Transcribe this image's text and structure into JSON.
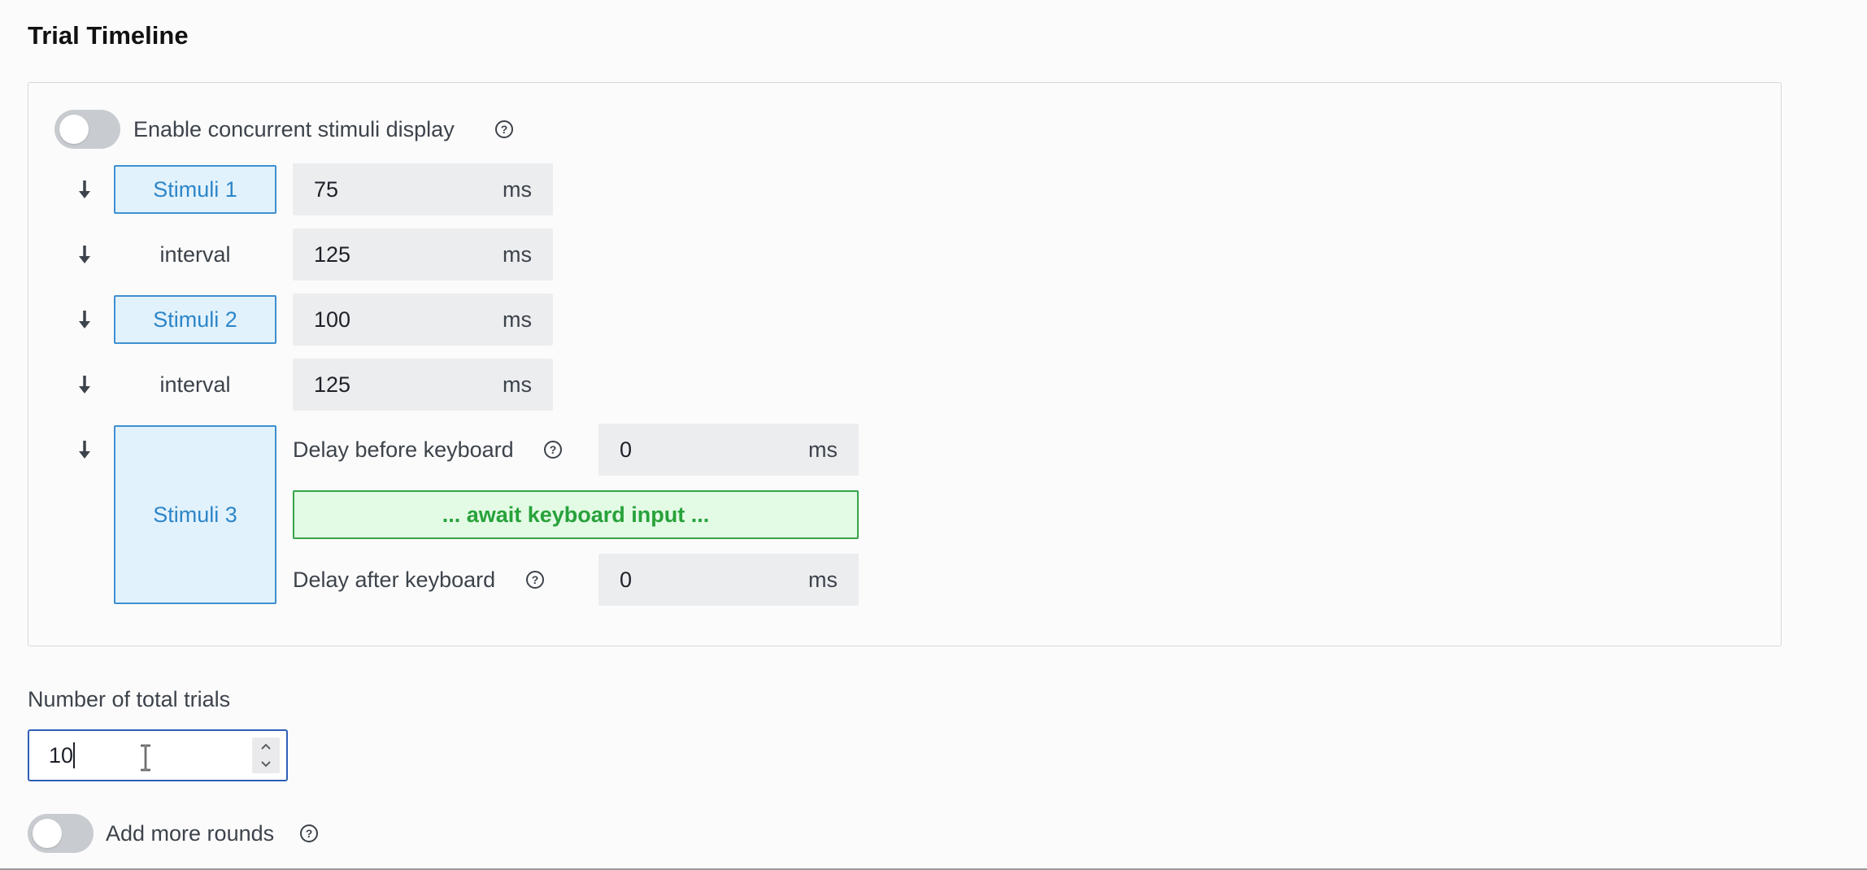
{
  "title": "Trial Timeline",
  "concurrent": {
    "label": "Enable concurrent stimuli display",
    "enabled": false
  },
  "timeline": [
    {
      "kind": "stimulus",
      "label": "Stimuli 1",
      "value": "75",
      "unit": "ms"
    },
    {
      "kind": "interval",
      "label": "interval",
      "value": "125",
      "unit": "ms"
    },
    {
      "kind": "stimulus",
      "label": "Stimuli 2",
      "value": "100",
      "unit": "ms"
    },
    {
      "kind": "interval",
      "label": "interval",
      "value": "125",
      "unit": "ms"
    }
  ],
  "stimulus3": {
    "label": "Stimuli 3",
    "delay_before_label": "Delay before keyboard",
    "delay_before_value": "0",
    "delay_before_unit": "ms",
    "await_label": "... await keyboard input ...",
    "delay_after_label": "Delay after keyboard",
    "delay_after_value": "0",
    "delay_after_unit": "ms"
  },
  "total_trials": {
    "label": "Number of total trials",
    "value": "10"
  },
  "more_rounds": {
    "label": "Add more rounds",
    "enabled": false
  },
  "colors": {
    "stimulus_border": "#3f8fd0",
    "stimulus_fill": "#e2f2fc",
    "await_border": "#35a44a",
    "await_fill": "#e3fae5",
    "toggle_off": "#c8cbd0",
    "focus_border": "#2e5fb6"
  },
  "icons": [
    "question-circle-icon",
    "arrow-down-icon",
    "chevron-up-icon",
    "chevron-down-icon",
    "text-cursor-icon"
  ]
}
